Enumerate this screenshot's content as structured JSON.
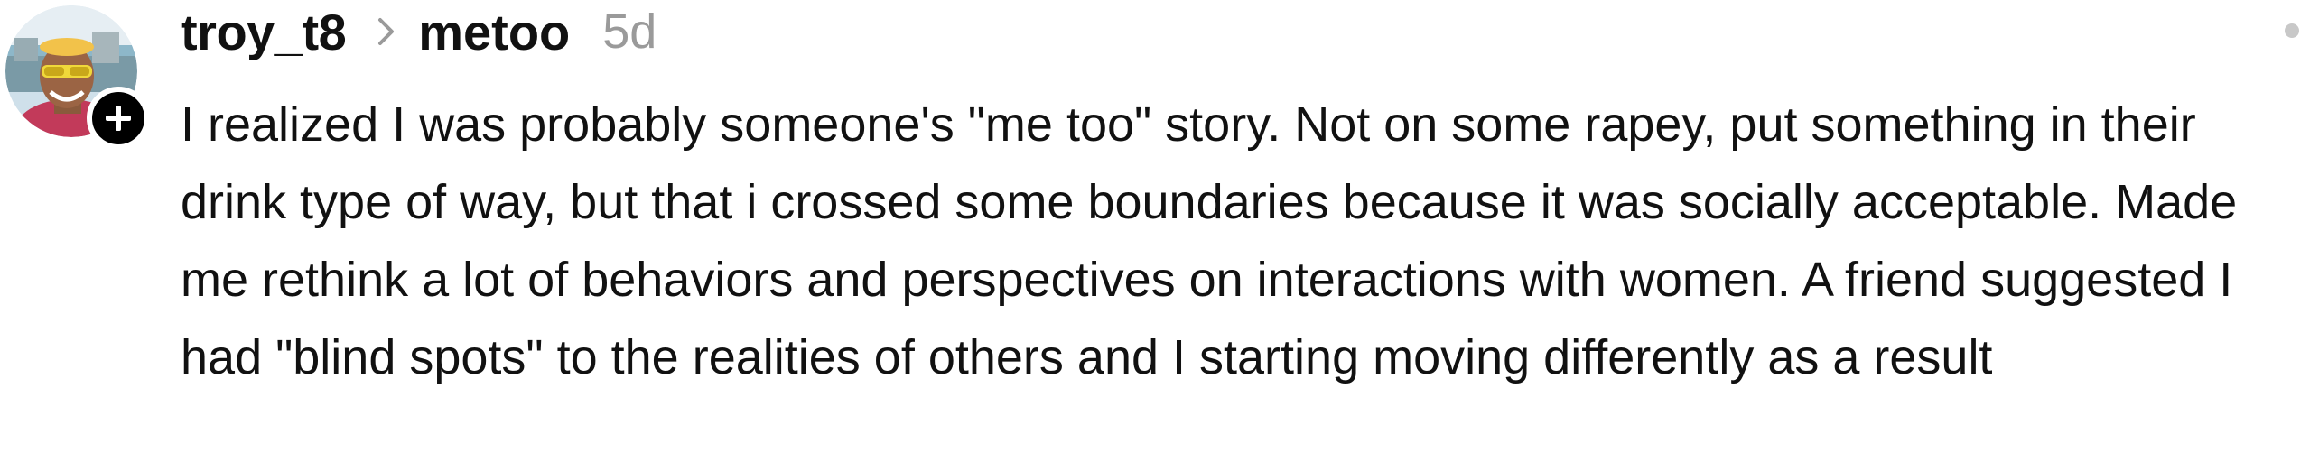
{
  "post": {
    "author": "troy_t8",
    "community": "metoo",
    "timestamp": "5d",
    "body": "I realized I was probably someone's \"me too\" story. Not on some rapey, put something in their drink type of way, but that i crossed some boundaries because it was socially acceptable. Made me rethink a lot of behaviors and perspectives on interactions with women. A friend suggested I had \"blind spots\" to the realities of others and I starting moving differently as a result"
  },
  "icons": {
    "follow": "plus-icon",
    "separator": "chevron-right-icon",
    "menu": "more-options-icon"
  },
  "colors": {
    "text": "#111111",
    "muted": "#9a9a9a",
    "badge": "#000000"
  }
}
